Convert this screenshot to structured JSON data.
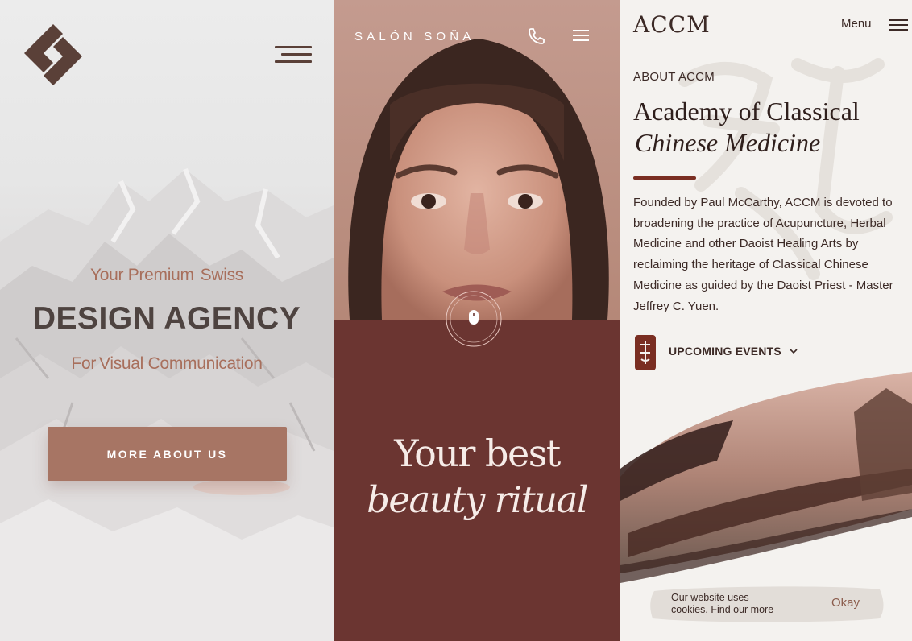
{
  "agency": {
    "tagline_a": "Your Premium",
    "tagline_b": "Swiss",
    "headline": "DESIGN AGENCY",
    "subline_a": "For",
    "subline_b": "Visual Communication",
    "cta_label": "MORE ABOUT US",
    "colors": {
      "accent": "#a77564",
      "heading": "#4e4340",
      "brand": "#5a4038"
    }
  },
  "salon": {
    "brand": "SALÓN SOŇA",
    "title_line1": "Your best",
    "title_line2": "beauty ritual",
    "icons": [
      "phone-icon",
      "menu-icon",
      "scroll-mouse-icon"
    ],
    "colors": {
      "background": "#6b3531",
      "text": "#f6ece8"
    }
  },
  "accm": {
    "logo": "ACCM",
    "menu_label": "Menu",
    "eyebrow": "ABOUT ACCM",
    "heading_line1": "Academy of Classical",
    "heading_line2": "Chinese Medicine",
    "body": "Founded by Paul McCarthy, ACCM is devoted to broadening the practice of Acupuncture, Herbal Medicine and other Daoist Healing Arts by reclaiming the heritage of Classical Chinese Medicine as guided by the Daoist Priest - Master Jeffrey C. Yuen.",
    "events_label": "UPCOMING EVENTS",
    "cookie": {
      "text": "Our website uses cookies.",
      "link": "Find our more",
      "button": "Okay"
    },
    "colors": {
      "accent": "#7a2e22",
      "text": "#3c2a26"
    }
  }
}
